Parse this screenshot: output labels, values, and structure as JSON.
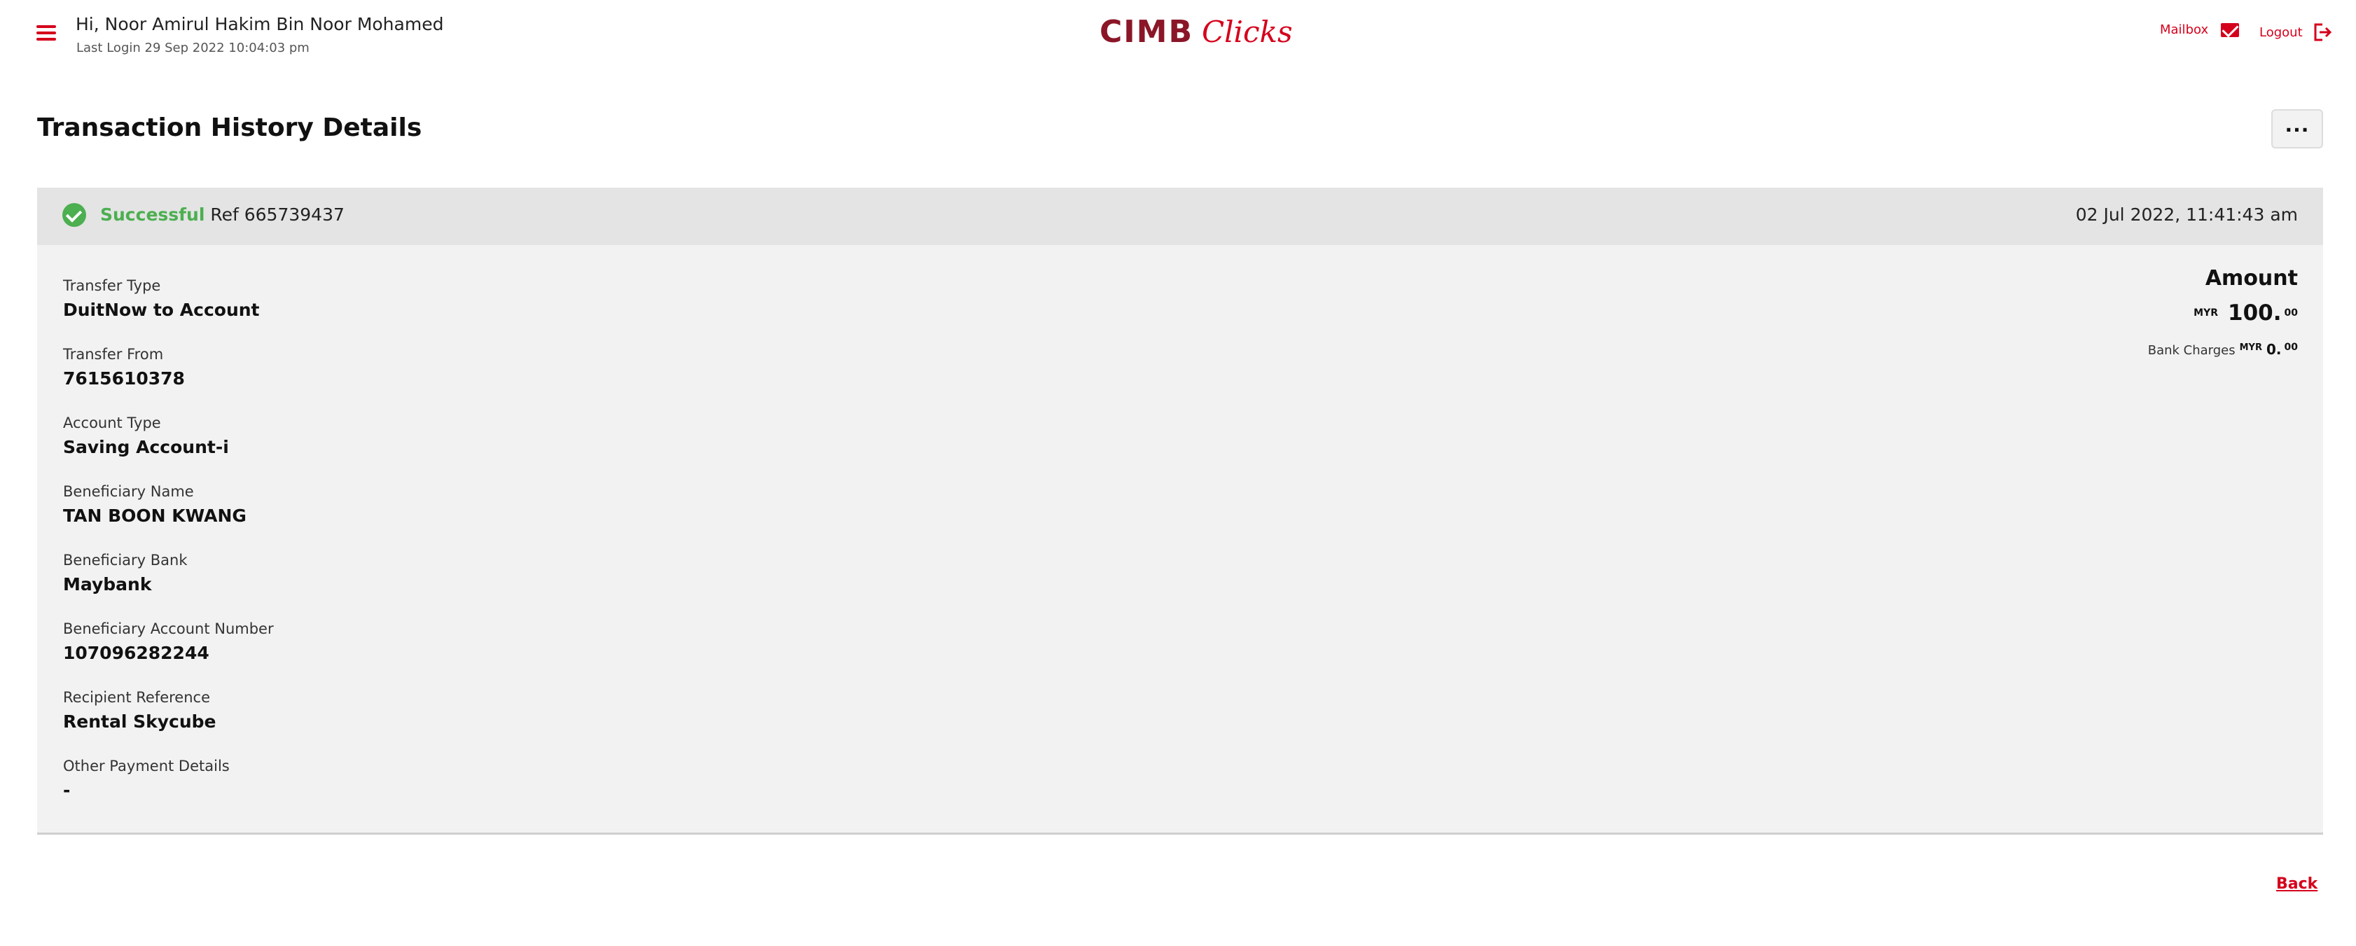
{
  "header": {
    "greeting": "Hi, Noor Amirul Hakim Bin Noor Mohamed",
    "last_login": "Last Login 29 Sep 2022 10:04:03 pm",
    "logo_primary": "CIMB",
    "logo_secondary": "Clicks",
    "mailbox_label": "Mailbox",
    "logout_label": "Logout"
  },
  "page": {
    "title": "Transaction History Details",
    "more_label": "..."
  },
  "status": {
    "word": "Successful",
    "ref": "Ref 665739437",
    "datetime": "02 Jul 2022, 11:41:43 am",
    "color": "#4caf50"
  },
  "fields": [
    {
      "label": "Transfer Type",
      "value": "DuitNow to Account"
    },
    {
      "label": "Transfer From",
      "value": "7615610378"
    },
    {
      "label": "Account Type",
      "value": "Saving Account-i"
    },
    {
      "label": "Beneficiary Name",
      "value": "TAN BOON KWANG"
    },
    {
      "label": "Beneficiary Bank",
      "value": "Maybank"
    },
    {
      "label": "Beneficiary Account Number",
      "value": "107096282244"
    },
    {
      "label": "Recipient Reference",
      "value": "Rental Skycube"
    },
    {
      "label": "Other Payment Details",
      "value": "-"
    }
  ],
  "amount": {
    "label": "Amount",
    "currency": "MYR",
    "whole": "100.",
    "decimal": "00",
    "charges_label": "Bank Charges",
    "charges_currency": "MYR",
    "charges_whole": "0.",
    "charges_decimal": "00"
  },
  "footer": {
    "back_label": "Back"
  },
  "colors": {
    "brand_red": "#d5001c",
    "brand_maroon": "#8a1628",
    "card_bg": "#f2f2f2",
    "status_bar_bg": "#e4e4e4"
  }
}
